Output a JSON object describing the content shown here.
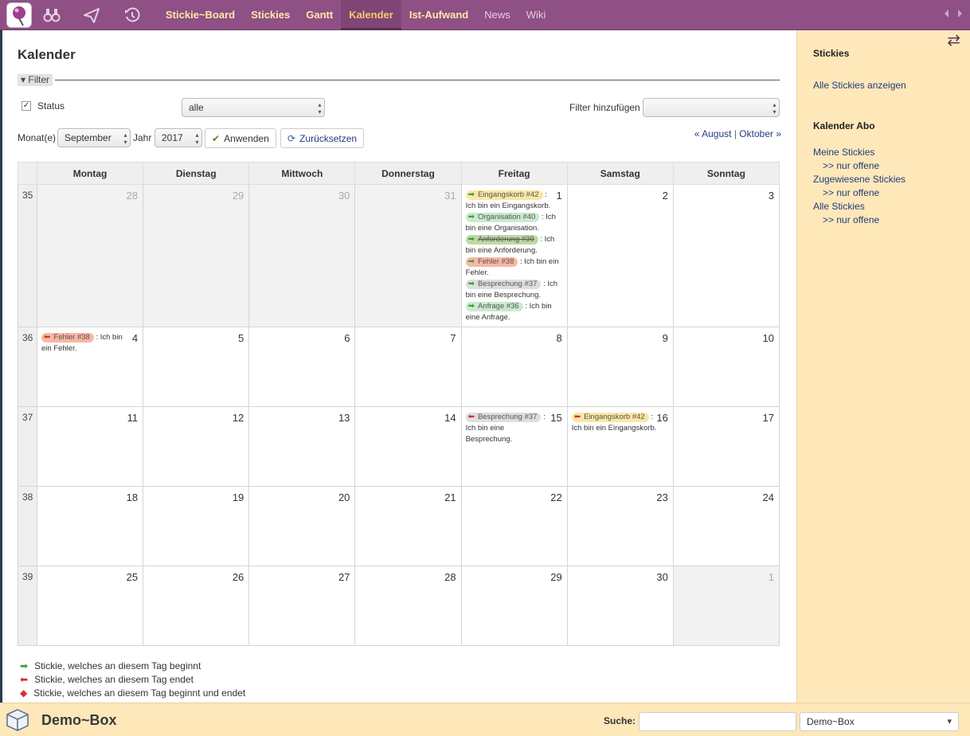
{
  "nav": {
    "links": [
      {
        "label": "Stickie~Board"
      },
      {
        "label": "Stickies"
      },
      {
        "label": "Gantt"
      },
      {
        "label": "Kalender"
      },
      {
        "label": "Ist-Aufwand"
      },
      {
        "label": "News"
      },
      {
        "label": "Wiki"
      }
    ],
    "active_index": 3,
    "icons": [
      "binoculars-icon",
      "paper-plane-icon",
      "history-icon"
    ]
  },
  "page": {
    "title": "Kalender",
    "filter_label": "Filter",
    "status_label": "Status",
    "status_checked": true,
    "status_value": "alle",
    "add_filter_label": "Filter hinzufügen",
    "add_filter_value": "",
    "months_label": "Monat(e)",
    "month_value": "September",
    "year_label": "Jahr",
    "year_value": "2017",
    "apply_label": "Anwenden",
    "reset_label": "Zurücksetzen",
    "prev_month": "« August",
    "next_month": "Oktober »",
    "separator": "|"
  },
  "calendar": {
    "weekdays": [
      "Montag",
      "Dienstag",
      "Mittwoch",
      "Donnerstag",
      "Freitag",
      "Samstag",
      "Sonntag"
    ],
    "weeks": [
      {
        "week": "35",
        "days": [
          {
            "num": "28",
            "other": true,
            "entries": []
          },
          {
            "num": "29",
            "other": true,
            "entries": []
          },
          {
            "num": "30",
            "other": true,
            "entries": []
          },
          {
            "num": "31",
            "other": true,
            "entries": []
          },
          {
            "num": "1",
            "other": false,
            "entries": [
              {
                "tag": "Eingangskorb #42",
                "arrow": "start",
                "color": "yellow",
                "text": ": Ich bin ein Eingangskorb."
              },
              {
                "tag": "Organisation #40",
                "arrow": "start",
                "color": "green",
                "text": ": Ich bin eine Organisation."
              },
              {
                "tag": "Anforderung #39",
                "arrow": "start",
                "color": "olive",
                "text": ": Ich bin eine Anforderung."
              },
              {
                "tag": "Fehler #38",
                "arrow": "start",
                "color": "red",
                "text": ": Ich bin ein Fehler."
              },
              {
                "tag": "Besprechung #37",
                "arrow": "start",
                "color": "gray",
                "text": ": Ich bin eine Besprechung."
              },
              {
                "tag": "Anfrage #36",
                "arrow": "start",
                "color": "green",
                "text": ": Ich bin eine Anfrage."
              }
            ]
          },
          {
            "num": "2",
            "other": false,
            "entries": []
          },
          {
            "num": "3",
            "other": false,
            "entries": []
          }
        ]
      },
      {
        "week": "36",
        "days": [
          {
            "num": "4",
            "other": false,
            "entries": [
              {
                "tag": "Fehler #38",
                "arrow": "end",
                "color": "red",
                "text": ": Ich bin ein Fehler."
              }
            ]
          },
          {
            "num": "5",
            "other": false,
            "entries": []
          },
          {
            "num": "6",
            "other": false,
            "entries": []
          },
          {
            "num": "7",
            "other": false,
            "entries": []
          },
          {
            "num": "8",
            "other": false,
            "entries": []
          },
          {
            "num": "9",
            "other": false,
            "entries": []
          },
          {
            "num": "10",
            "other": false,
            "entries": []
          }
        ]
      },
      {
        "week": "37",
        "days": [
          {
            "num": "11",
            "other": false,
            "entries": []
          },
          {
            "num": "12",
            "other": false,
            "entries": []
          },
          {
            "num": "13",
            "other": false,
            "entries": []
          },
          {
            "num": "14",
            "other": false,
            "entries": []
          },
          {
            "num": "15",
            "other": false,
            "entries": [
              {
                "tag": "Besprechung #37",
                "arrow": "end",
                "color": "gray",
                "text": ": Ich bin eine Besprechung."
              }
            ]
          },
          {
            "num": "16",
            "other": false,
            "entries": [
              {
                "tag": "Eingangskorb #42",
                "arrow": "end",
                "color": "yellow",
                "text": ": Ich bin ein Eingangskorb."
              }
            ]
          },
          {
            "num": "17",
            "other": false,
            "entries": []
          }
        ]
      },
      {
        "week": "38",
        "days": [
          {
            "num": "18",
            "other": false,
            "entries": []
          },
          {
            "num": "19",
            "other": false,
            "entries": []
          },
          {
            "num": "20",
            "other": false,
            "entries": []
          },
          {
            "num": "21",
            "other": false,
            "entries": []
          },
          {
            "num": "22",
            "other": false,
            "entries": []
          },
          {
            "num": "23",
            "other": false,
            "entries": []
          },
          {
            "num": "24",
            "other": false,
            "entries": []
          }
        ]
      },
      {
        "week": "39",
        "days": [
          {
            "num": "25",
            "other": false,
            "entries": []
          },
          {
            "num": "26",
            "other": false,
            "entries": []
          },
          {
            "num": "27",
            "other": false,
            "entries": []
          },
          {
            "num": "28",
            "other": false,
            "entries": []
          },
          {
            "num": "29",
            "other": false,
            "entries": []
          },
          {
            "num": "30",
            "other": false,
            "entries": []
          },
          {
            "num": "1",
            "other": true,
            "entries": []
          }
        ]
      }
    ]
  },
  "legend": {
    "start": "Stickie, welches an diesem Tag beginnt",
    "end": "Stickie, welches an diesem Tag endet",
    "both": "Stickie, welches an diesem Tag beginnt und endet"
  },
  "sidebar": {
    "stickies_heading": "Stickies",
    "show_all": "Alle Stickies anzeigen",
    "abo_heading": "Kalender Abo",
    "my_stickies": "Meine Stickies",
    "my_open": ">> nur offene",
    "assigned": "Zugewiesene Stickies",
    "assigned_open": ">> nur offene",
    "all_stickies": "Alle Stickies",
    "all_open": ">> nur offene"
  },
  "footer": {
    "title": "Demo~Box",
    "search_label": "Suche:",
    "search_value": "",
    "project_value": "Demo~Box"
  },
  "colors": {
    "nav_bg": "#8e5085",
    "nav_link": "#ffe8a6",
    "sidebar_bg": "#fee8ba",
    "link": "#233c7a",
    "start_arrow": "#3aa13a",
    "end_arrow": "#d43030"
  }
}
